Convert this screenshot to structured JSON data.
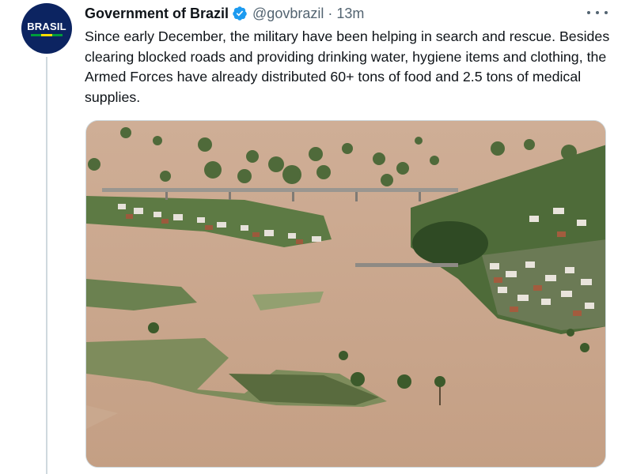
{
  "account": {
    "avatar_text": "BRASIL",
    "name": "Government of Brazil",
    "verified": true,
    "handle": "@govbrazil",
    "separator": "·",
    "time": "13m",
    "avatar_color": "#0c2461",
    "verified_color": "#1d9bf0"
  },
  "tweet": {
    "text": "Since early December, the military have been helping in search and rescue. Besides clearing blocked roads and providing drinking water, hygiene items and clothing, the Armed Forces have already distributed 60+ tons of food and 2.5 tons of medical supplies."
  },
  "media": {
    "description_icon": "aerial-flood-photo"
  },
  "icons": {
    "more": "more-options-icon",
    "verified": "verified-badge-icon"
  }
}
